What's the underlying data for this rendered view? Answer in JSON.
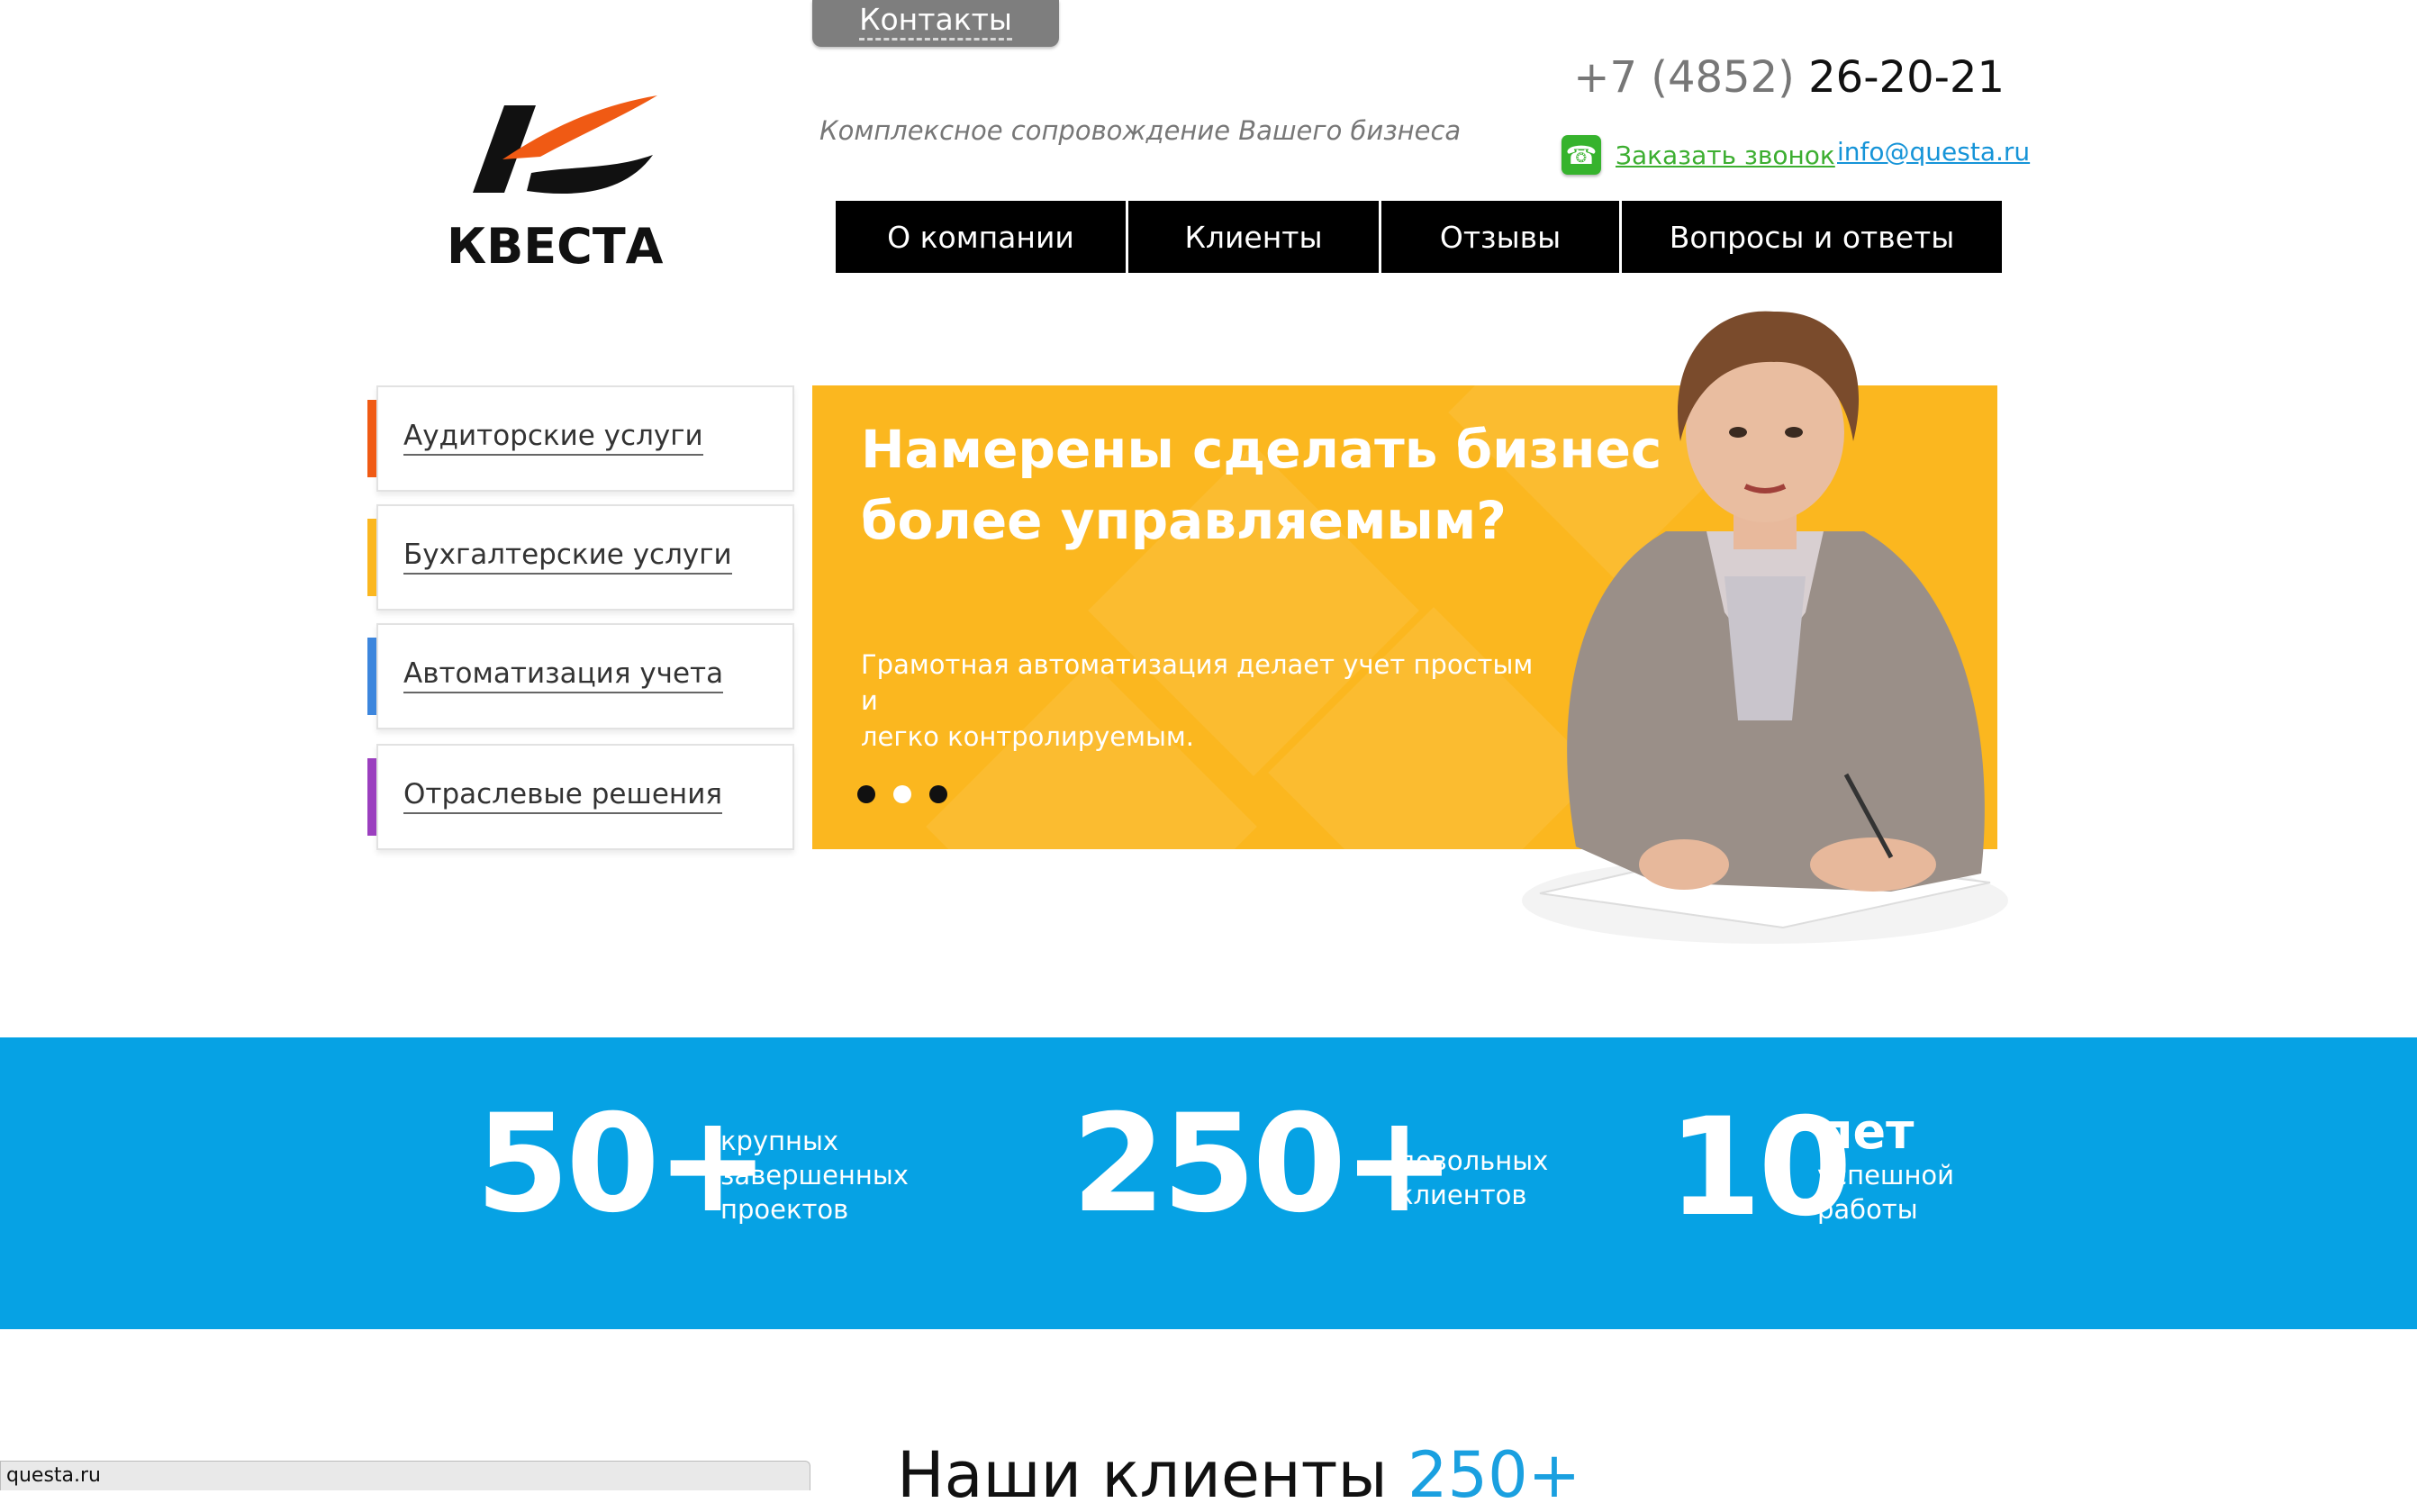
{
  "header": {
    "contacts_tab": "Контакты",
    "logo_text": "КВЕСТА",
    "tagline": "Комплексное сопровождение Вашего бизнеса",
    "phone_prefix": "+7 (4852)",
    "phone_number": "26-20-21",
    "callback_label": "Заказать звонок",
    "email": "info@questa.ru"
  },
  "nav": {
    "items": [
      {
        "label": "О компании"
      },
      {
        "label": "Клиенты"
      },
      {
        "label": "Отзывы"
      },
      {
        "label": "Вопросы и ответы"
      }
    ]
  },
  "services": {
    "items": [
      {
        "label": "Аудиторские услуги",
        "color": "#f05a14"
      },
      {
        "label": "Бухгалтерские услуги",
        "color": "#fbb71f"
      },
      {
        "label": "Автоматизация учета",
        "color": "#3d86dd"
      },
      {
        "label": "Отраслевые решения",
        "color": "#9b3fbf"
      }
    ]
  },
  "banner": {
    "headline_line1": "Намерены сделать бизнес",
    "headline_line2": "более управляемым?",
    "text_line1": "Грамотная автоматизация делает учет простым и",
    "text_line2": "легко контролируемым.",
    "slides_total": 3,
    "active_slide": 2,
    "background_color": "#fbb71f"
  },
  "stats": {
    "band_color": "#06a2e4",
    "items": [
      {
        "number": "50+",
        "lines": [
          "крупных",
          "завершенных",
          "проектов"
        ]
      },
      {
        "number": "250+",
        "lines": [
          "довольных",
          "клиентов"
        ]
      },
      {
        "number": "10",
        "lines": [
          "лет",
          "успешной",
          "работы"
        ]
      }
    ]
  },
  "clients_section": {
    "heading": "Наши клиенты",
    "count": "250+"
  },
  "status_bar": {
    "url": "questa.ru"
  }
}
